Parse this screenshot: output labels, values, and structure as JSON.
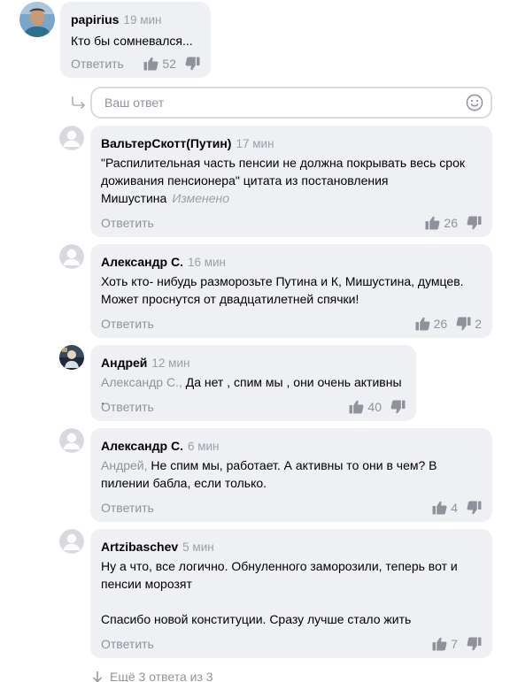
{
  "icons": {
    "like": "thumbs-up-icon",
    "dislike": "thumbs-down-icon",
    "reply_arrow": "reply-arrow-icon",
    "emoji": "smile-icon",
    "more": "arrow-down-icon"
  },
  "colors": {
    "bubble": "#eff0f3",
    "muted": "#8e939b",
    "text": "#000000"
  },
  "top_comment": {
    "author": "papirius",
    "time": "19 мин",
    "text": "Кто бы сомневался...",
    "reply_label": "Ответить",
    "likes": "52"
  },
  "reply_box": {
    "placeholder": "Ваш ответ"
  },
  "comments": [
    {
      "author": "ВальтерСкотт(Путин)",
      "time": "17 мин",
      "text": "\"Распилительная часть пенсии не должна покрывать весь срок доживания пенсионера\" цитата из постановления Мишустина",
      "edited": "Изменено",
      "reply_label": "Ответить",
      "likes": "26"
    },
    {
      "author": "Александр С.",
      "time": "16 мин",
      "text": "Хоть кто- нибудь разморозьте Путина и К, Мишустина, думцев. Может проснутся от двадцатилетней спячки!",
      "reply_label": "Ответить",
      "likes": "26",
      "dislikes": "2"
    },
    {
      "author": "Андрей",
      "time": "12 мин",
      "mention": "Александр С.,",
      "text": " Да нет , спим мы , они очень активны .",
      "reply_label": "Ответить",
      "likes": "40"
    },
    {
      "author": "Александр С.",
      "time": "6 мин",
      "mention": "Андрей,",
      "text": " Не спим мы, работает. А активны то они в чем?  В пилении бабла, если только.",
      "reply_label": "Ответить",
      "likes": "4"
    },
    {
      "author": "Artzibaschev",
      "time": "5 мин",
      "text_p1": "Ну а что, все логично. Обнуленного заморозили, теперь вот и пенсии морозят",
      "text_p2": "Спасибо новой конституции. Сразу лучше стало жить",
      "reply_label": "Ответить",
      "likes": "7"
    }
  ],
  "more_replies": "Ещё 3 ответа из 3"
}
